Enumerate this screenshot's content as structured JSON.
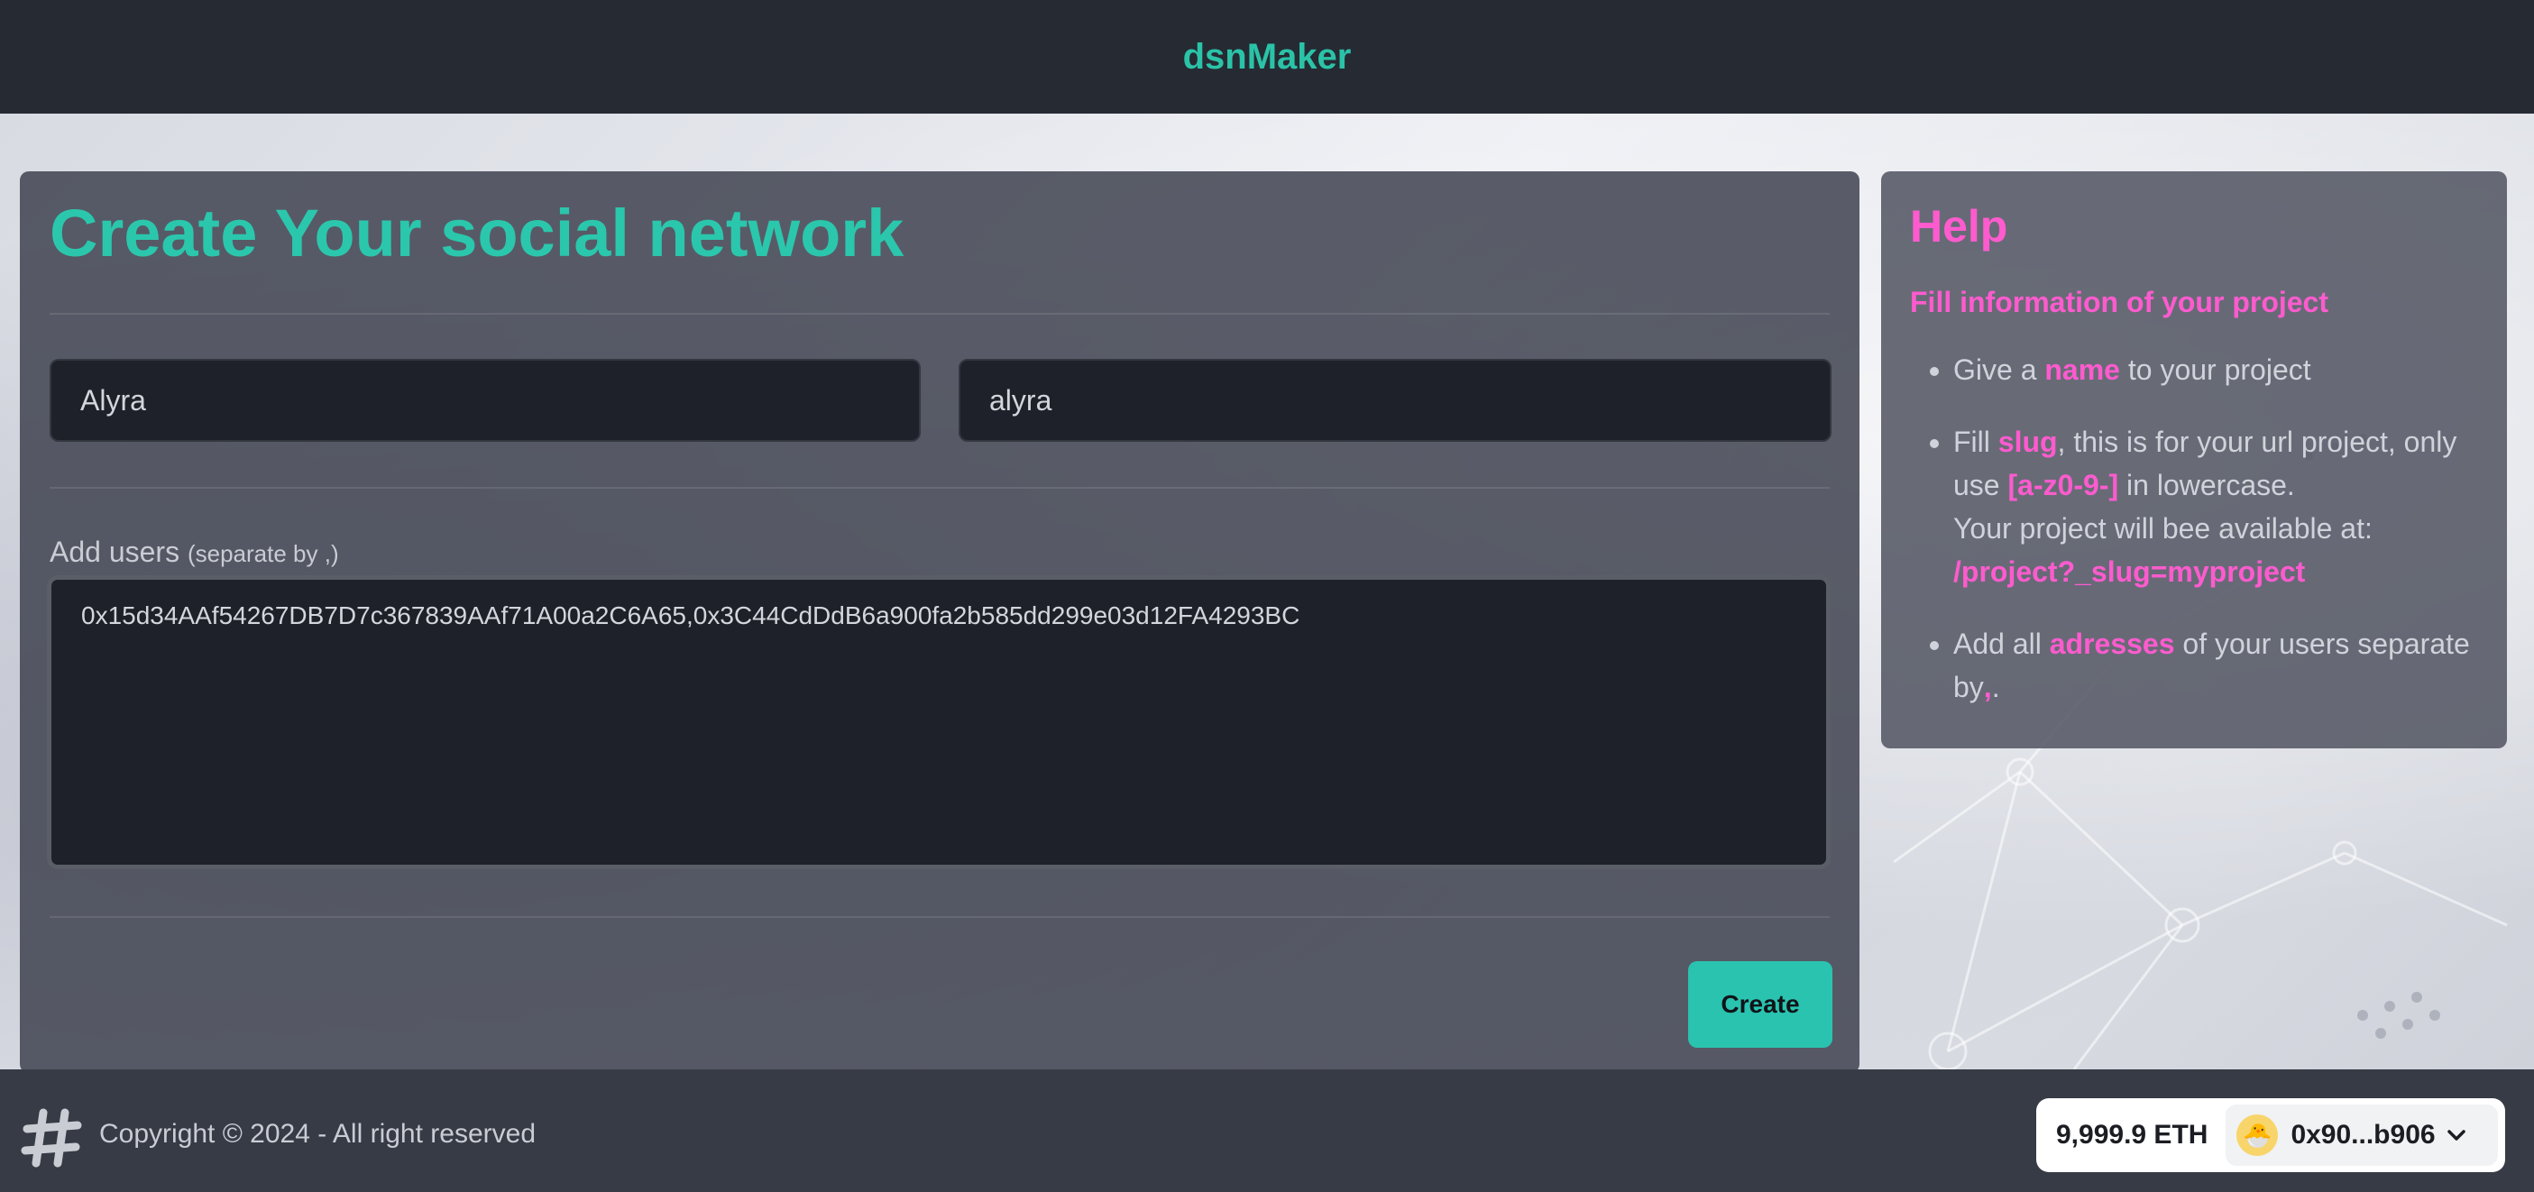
{
  "header": {
    "brand": "dsnMaker"
  },
  "form": {
    "title": "Create Your social network",
    "name_value": "Alyra",
    "slug_value": "alyra",
    "users_label": "Add users",
    "users_hint": "(separate by ,)",
    "users_value": "0x15d34AAf54267DB7D7c367839AAf71A00a2C6A65,0x3C44CdDdB6a900fa2b585dd299e03d12FA4293BC",
    "create_label": "Create"
  },
  "help": {
    "title": "Help",
    "subtitle": "Fill information of your project",
    "item1": {
      "pre": "Give a ",
      "hl": "name",
      "post": " to your project"
    },
    "item2": {
      "pre": "Fill ",
      "hl": "slug",
      "mid": ", this is for your url project, only use ",
      "hl2": "[a-z0-9-]",
      "post": " in lowercase.",
      "line2": "Your project will bee available at:",
      "url": "/project?_slug=myproject"
    },
    "item3": {
      "pre": "Add all ",
      "hl": "adresses",
      "mid": " of your users separate by",
      "sep": ",",
      "post": "."
    }
  },
  "footer": {
    "copyright": "Copyright © 2024 - All right reserved",
    "balance": "9,999.9 ETH",
    "address": "0x90...b906",
    "avatar_emoji": "🐣"
  },
  "colors": {
    "accent": "#2ac3a8",
    "help_highlight": "#ff5bcf",
    "header_bg": "#262a33",
    "footer_bg": "#363b45"
  },
  "icons": {
    "footer_logo": "hashtag-icon",
    "wallet_chevron": "chevron-down-icon"
  }
}
